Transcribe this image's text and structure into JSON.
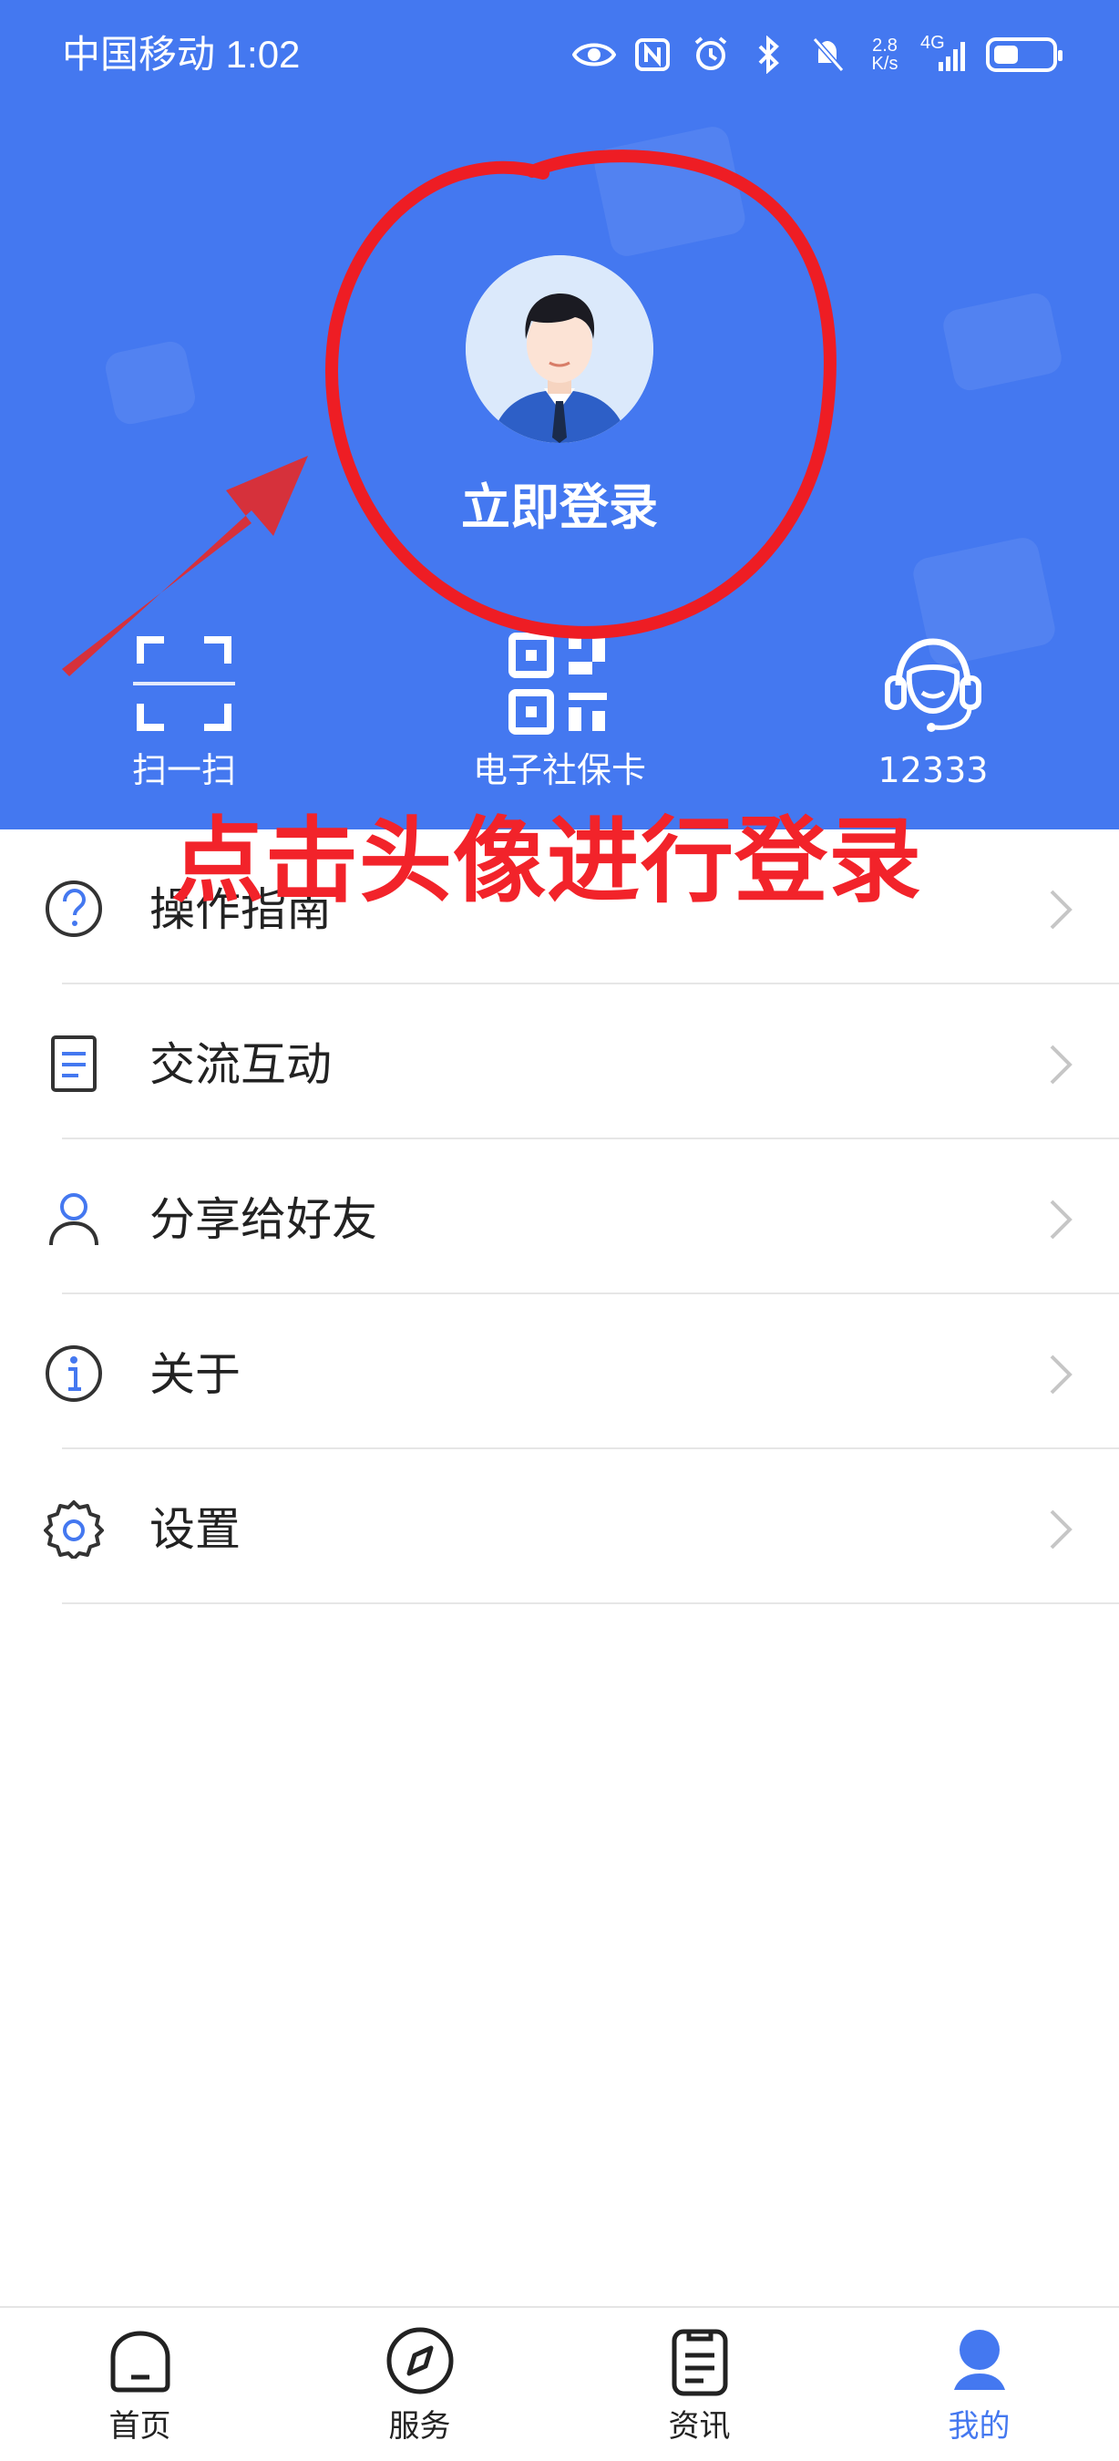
{
  "status_bar": {
    "carrier_time": "中国移动 1:02",
    "net_speed": "2.8\nK/s",
    "network": "4G"
  },
  "header": {
    "login_label": "立即登录",
    "quick_actions": [
      {
        "label": "扫一扫",
        "icon": "scan-icon"
      },
      {
        "label": "电子社保卡",
        "icon": "qr-code-icon"
      },
      {
        "label": "12333",
        "icon": "customer-service-icon"
      }
    ]
  },
  "annotation": {
    "text": "点击头像进行登录",
    "color": "#f2232a"
  },
  "menu": {
    "items": [
      {
        "label": "操作指南",
        "icon": "help-icon"
      },
      {
        "label": "交流互动",
        "icon": "document-icon"
      },
      {
        "label": "分享给好友",
        "icon": "user-icon"
      },
      {
        "label": "关于",
        "icon": "info-icon"
      },
      {
        "label": "设置",
        "icon": "gear-icon"
      }
    ]
  },
  "bottom_nav": {
    "items": [
      {
        "label": "首页",
        "icon": "home-icon"
      },
      {
        "label": "服务",
        "icon": "compass-icon"
      },
      {
        "label": "资讯",
        "icon": "news-icon"
      },
      {
        "label": "我的",
        "icon": "profile-icon",
        "active": true
      }
    ],
    "active_color": "#4478f0"
  },
  "colors": {
    "primary": "#4478f0",
    "text": "#222222",
    "divider": "#e6e6e6"
  }
}
